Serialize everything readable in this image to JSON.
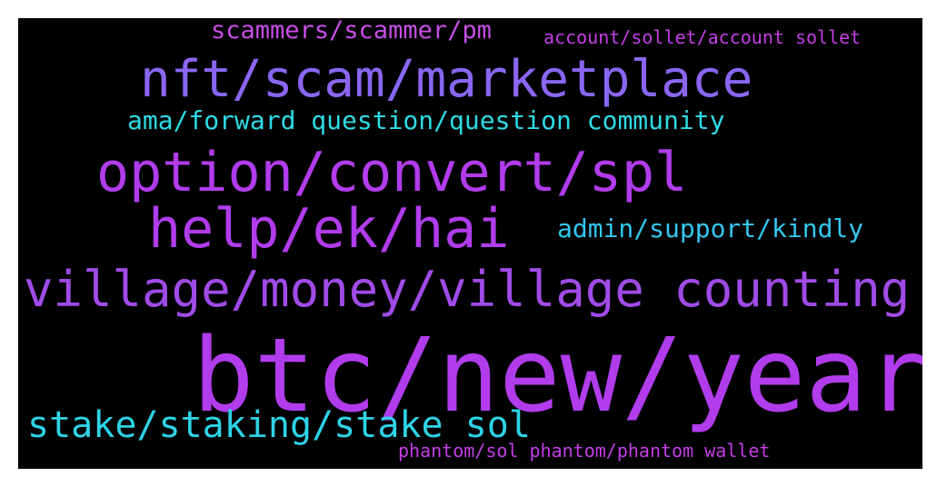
{
  "wordcloud": {
    "background": "#000000",
    "words": [
      {
        "text": "btc/new/years",
        "color": "#b13cec"
      },
      {
        "text": "option/convert/spl",
        "color": "#b13cec"
      },
      {
        "text": "help/ek/hai",
        "color": "#b13cec"
      },
      {
        "text": "village/money/village counting",
        "color": "#a04be8"
      },
      {
        "text": "nft/scam/marketplace",
        "color": "#8a66f2"
      },
      {
        "text": "stake/staking/stake sol",
        "color": "#2ed3e6"
      },
      {
        "text": "ama/forward question/question community",
        "color": "#2fdbe6"
      },
      {
        "text": "admin/support/kindly",
        "color": "#35c6ee"
      },
      {
        "text": "scammers/scammer/pm",
        "color": "#c74fe6"
      },
      {
        "text": "account/sollet/account sollet",
        "color": "#c43ee6"
      },
      {
        "text": "phantom/sol phantom/phantom wallet",
        "color": "#c43ee6"
      }
    ]
  }
}
